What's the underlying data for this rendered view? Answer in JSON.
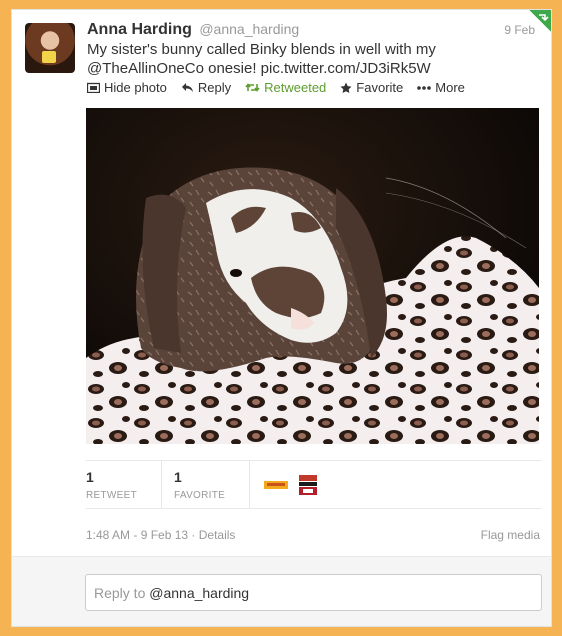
{
  "tweet": {
    "fullname": "Anna Harding",
    "username": "@anna_harding",
    "date": "9 Feb",
    "text_line1": "My sister's bunny called Binky blends in well with my",
    "mention": "@TheAllinOneCo",
    "text_mid": " onesie! ",
    "pic_link": "pic.twitter.com/JD3iRk5W"
  },
  "actions": {
    "hide_photo": "Hide photo",
    "reply": "Reply",
    "retweeted": "Retweeted",
    "favorite": "Favorite",
    "more": "More"
  },
  "stats": {
    "retweets": "1",
    "retweet_label": "RETWEET",
    "favorites": "1",
    "favorite_label": "FAVORITE"
  },
  "meta": {
    "timestamp": "1:48 AM - 9 Feb 13",
    "sep": " · ",
    "details": "Details",
    "flag": "Flag media"
  },
  "reply": {
    "placeholder": "Reply to ",
    "to": "@anna_harding"
  },
  "colors": {
    "frame": "#f5b354",
    "retweeted": "#5c9e2e",
    "corner": "#3ea84a"
  },
  "icons": [
    "corner-retweet-icon",
    "hide-photo-icon",
    "reply-icon",
    "retweet-icon",
    "star-icon",
    "more-icon"
  ],
  "faces": [
    "onesie-logo-avatar",
    "radio-uk-avatar"
  ]
}
